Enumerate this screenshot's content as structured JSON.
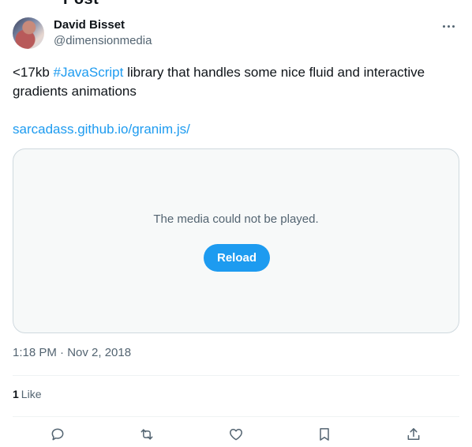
{
  "page": {
    "top_clipped_text": "Post"
  },
  "author": {
    "name": "David Bisset",
    "handle": "@dimensionmedia"
  },
  "tweet": {
    "text_before": "<17kb ",
    "hashtag": "#JavaScript",
    "text_after": " library that handles some nice fluid and interactive gradients animations",
    "link": "sarcadass.github.io/granim.js/"
  },
  "media": {
    "message": "The media could not be played.",
    "reload_label": "Reload"
  },
  "meta": {
    "timestamp": "1:18 PM · Nov 2, 2018"
  },
  "stats": {
    "like_count": "1",
    "like_label": "Like"
  },
  "actions": [
    "reply-icon",
    "retweet-icon",
    "like-icon",
    "bookmark-icon",
    "share-icon"
  ],
  "colors": {
    "accent": "#1d9bf0",
    "text": "#0f1419",
    "secondary": "#536471",
    "border": "#cfd9de",
    "media_bg": "#f7f9f9"
  }
}
